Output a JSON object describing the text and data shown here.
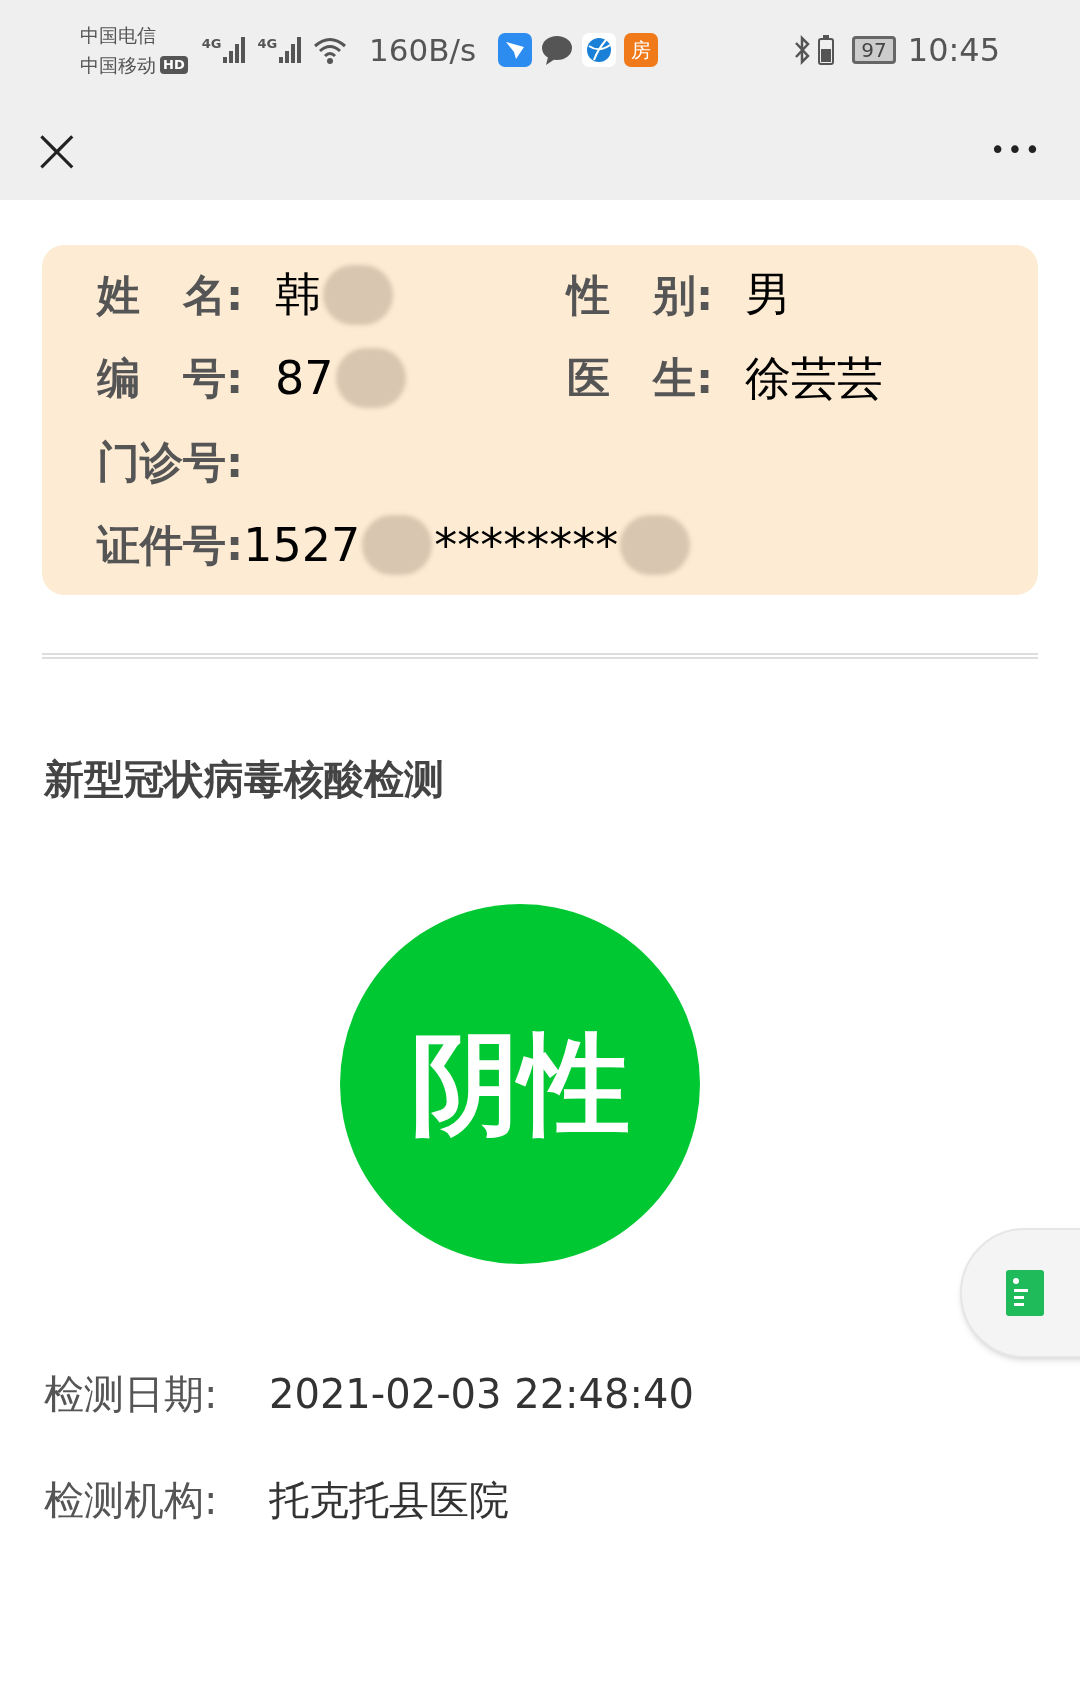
{
  "status_bar": {
    "carriers": [
      "中国电信",
      "中国移动"
    ],
    "hd_badge": "HD",
    "network_type": [
      "4G",
      "4G"
    ],
    "speed": "160B/s",
    "app_icons": [
      {
        "kind": "bird"
      },
      {
        "kind": "chat"
      },
      {
        "kind": "globe"
      },
      {
        "kind": "house",
        "glyph": "房"
      }
    ],
    "battery": "97",
    "time": "10:45"
  },
  "nav": {
    "close": "×",
    "more": "•••"
  },
  "patient_card": {
    "rows": [
      {
        "fields": [
          {
            "label": "姓　名:",
            "parts": [
              {
                "kind": "text",
                "text": "韩"
              },
              {
                "kind": "mask"
              }
            ]
          },
          {
            "label": "性　别:",
            "parts": [
              {
                "kind": "text",
                "text": "男"
              }
            ]
          }
        ]
      },
      {
        "fields": [
          {
            "label": "编　号:",
            "parts": [
              {
                "kind": "text",
                "text": "87"
              },
              {
                "kind": "mask"
              }
            ]
          },
          {
            "label": "医　生:",
            "parts": [
              {
                "kind": "text",
                "text": "徐芸芸"
              }
            ]
          }
        ]
      },
      {
        "fields": [
          {
            "label": "门诊号:"
          }
        ]
      },
      {
        "fields": [
          {
            "label": "证件号:",
            "parts": [
              {
                "kind": "text",
                "text": "1527"
              },
              {
                "kind": "mask"
              },
              {
                "kind": "text",
                "text": "********"
              },
              {
                "kind": "mask"
              }
            ]
          }
        ]
      }
    ]
  },
  "test": {
    "title": "新型冠状病毒核酸检测",
    "result": "阴性",
    "details": [
      {
        "label": "检测日期:",
        "value": "2021-02-03 22:48:40"
      },
      {
        "label": "检测机构:",
        "value": "托克托县医院"
      }
    ]
  }
}
